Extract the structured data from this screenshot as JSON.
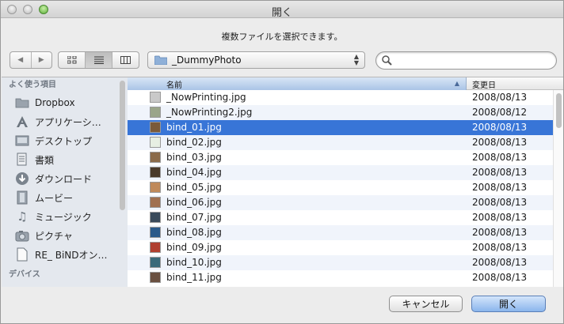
{
  "window": {
    "title": "開く",
    "message": "複数ファイルを選択できます。"
  },
  "toolbar": {
    "back_icon": "back-arrow-icon",
    "forward_icon": "forward-arrow-icon",
    "view_modes": [
      "icon-view-icon",
      "list-view-icon",
      "column-view-icon"
    ],
    "active_view": "list",
    "path": "_DummyPhoto",
    "search_placeholder": "",
    "search_value": ""
  },
  "sidebar": {
    "favorites_header": "よく使う項目",
    "items": [
      {
        "label": "Dropbox",
        "icon": "folder-icon"
      },
      {
        "label": "アプリケーシ…",
        "icon": "applications-icon"
      },
      {
        "label": "デスクトップ",
        "icon": "desktop-icon"
      },
      {
        "label": "書類",
        "icon": "documents-icon"
      },
      {
        "label": "ダウンロード",
        "icon": "downloads-icon"
      },
      {
        "label": "ムービー",
        "icon": "movies-icon"
      },
      {
        "label": "ミュージック",
        "icon": "music-icon"
      },
      {
        "label": "ピクチャ",
        "icon": "pictures-icon"
      },
      {
        "label": "RE_ BiNDオン…",
        "icon": "document-icon"
      }
    ],
    "devices_header": "デバイス"
  },
  "filelist": {
    "columns": {
      "name": "名前",
      "date": "変更日"
    },
    "sort": "name-ascending",
    "selected_index": 2,
    "rows": [
      {
        "name": "_NowPrinting.jpg",
        "date": "2008/08/13"
      },
      {
        "name": "_NowPrinting2.jpg",
        "date": "2008/08/12"
      },
      {
        "name": "bind_01.jpg",
        "date": "2008/08/13"
      },
      {
        "name": "bind_02.jpg",
        "date": "2008/08/13"
      },
      {
        "name": "bind_03.jpg",
        "date": "2008/08/13"
      },
      {
        "name": "bind_04.jpg",
        "date": "2008/08/13"
      },
      {
        "name": "bind_05.jpg",
        "date": "2008/08/13"
      },
      {
        "name": "bind_06.jpg",
        "date": "2008/08/13"
      },
      {
        "name": "bind_07.jpg",
        "date": "2008/08/13"
      },
      {
        "name": "bind_08.jpg",
        "date": "2008/08/13"
      },
      {
        "name": "bind_09.jpg",
        "date": "2008/08/13"
      },
      {
        "name": "bind_10.jpg",
        "date": "2008/08/13"
      },
      {
        "name": "bind_11.jpg",
        "date": "2008/08/13"
      }
    ]
  },
  "buttons": {
    "cancel": "キャンセル",
    "open": "開く"
  },
  "colors": {
    "selection": "#3875d7",
    "default_button": "#8ab5ec"
  }
}
